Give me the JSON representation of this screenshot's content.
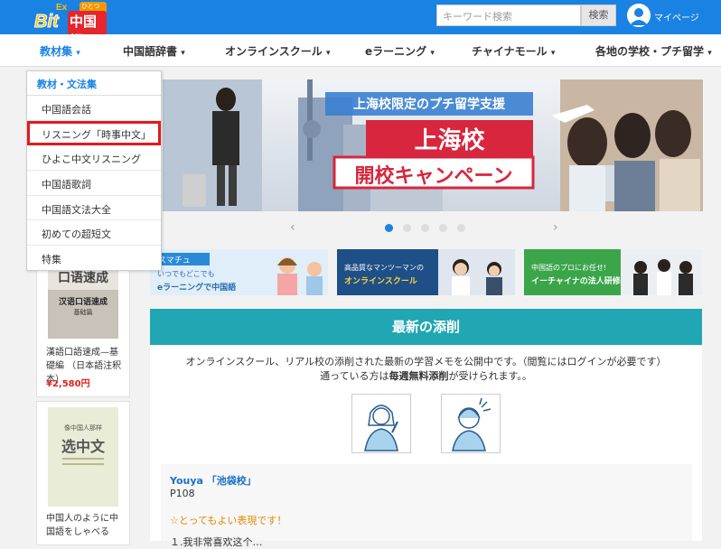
{
  "header": {
    "logo_bit": "Bit",
    "logo_ex": "Ex",
    "logo_cn": "中国語",
    "logo_badge": "ひとつき",
    "search_placeholder": "キーワード検索",
    "search_button": "検索",
    "mypage": "マイページ"
  },
  "nav": {
    "items": [
      {
        "label": "教材集",
        "caret": "▾"
      },
      {
        "label": "中国語辞書",
        "caret": "▾"
      },
      {
        "label": "オンラインスクール",
        "caret": "▾"
      },
      {
        "label": "eラーニング",
        "caret": "▾"
      },
      {
        "label": "チャイナモール",
        "caret": "▾"
      },
      {
        "label": "各地の学校・プチ留学",
        "caret": "▾"
      }
    ]
  },
  "dropdown": {
    "header": "教材・文法集",
    "items": [
      "中国語会話",
      "リスニング「時事中文」",
      "ひよこ中文リスニング",
      "中国語歌詞",
      "中国語文法大全",
      "初めての超短文",
      "特集"
    ],
    "selected_index": 1
  },
  "books": [
    {
      "cover_title": "口语速成",
      "cover_sub": "汉语口语速成",
      "cover_level": "基础篇",
      "title": "漢語口語速成—基礎編 （日本語注釈本）",
      "price": "¥2,580円"
    },
    {
      "cover_title": "选中文",
      "cover_sub": "像中国人那样",
      "title": "中国人のように中国語をしゃべる"
    }
  ],
  "hero": {
    "tagline": "上海校限定のプチ留学支援",
    "title": "上海校",
    "subtitle": "開校キャンペーン"
  },
  "carousel": {
    "prev": "‹",
    "next": "›",
    "dots": 5,
    "active_dot": 0
  },
  "banners": [
    {
      "logo": "スマチュ",
      "line1": "いつでもどこでも",
      "line2": "eラーニングで中国語"
    },
    {
      "line1": "高品質なマンツーマンの",
      "line2": "オンラインスクール"
    },
    {
      "line1": "中国語のプロにお任せ!",
      "line2": "イーチャイナの法人研修"
    }
  ],
  "section": {
    "title": "最新の添削",
    "desc_line1": "オンラインスクール、リアル校の添削された最新の学習メモを公開中です。（閲覧にはログインが必要です）",
    "desc_line2_pre": "通っている方は",
    "desc_line2_bold": "毎週無料添削",
    "desc_line2_post": "が受けられます。。"
  },
  "card": {
    "name": "Youya 「池袋校」",
    "page": "P108",
    "comment": "☆とってもよい表現です！",
    "line": "１.我非常喜欢这个…"
  },
  "colors": {
    "topbar": "#1a82e2",
    "section_head": "#21a6b3",
    "highlight": "#e01a22",
    "price": "#e02020"
  }
}
